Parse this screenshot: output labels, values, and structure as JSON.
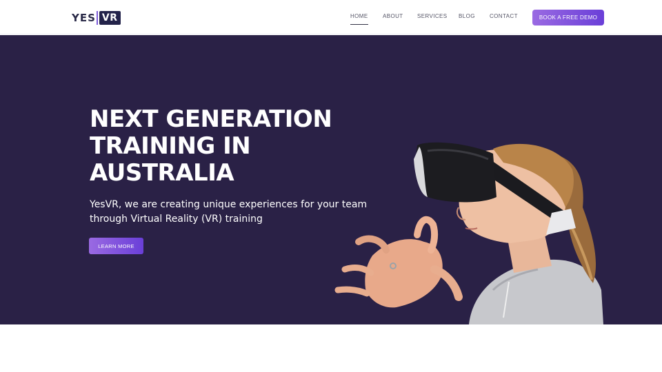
{
  "brand": {
    "logo_yes": "YES",
    "logo_vr": "VR"
  },
  "nav": {
    "items": [
      {
        "label": "HOME",
        "active": true
      },
      {
        "label": "ABOUT"
      },
      {
        "label": "SERVICES"
      },
      {
        "label": "BLOG"
      },
      {
        "label": "CONTACT"
      }
    ],
    "cta_label": "BOOK A FREE DEMO"
  },
  "hero": {
    "title": "NEXT GENERATION TRAINING IN AUSTRALIA",
    "subtitle": "YesVR, we are creating unique experiences for your team through Virtual Reality (VR) training",
    "button_label": "LEARN MORE",
    "image_icon": "vr-headset-person-image"
  },
  "colors": {
    "hero_bg": "#2a2146",
    "accent_start": "#9a6ae2",
    "accent_end": "#6a3fd8",
    "logo_dark": "#23234a"
  }
}
